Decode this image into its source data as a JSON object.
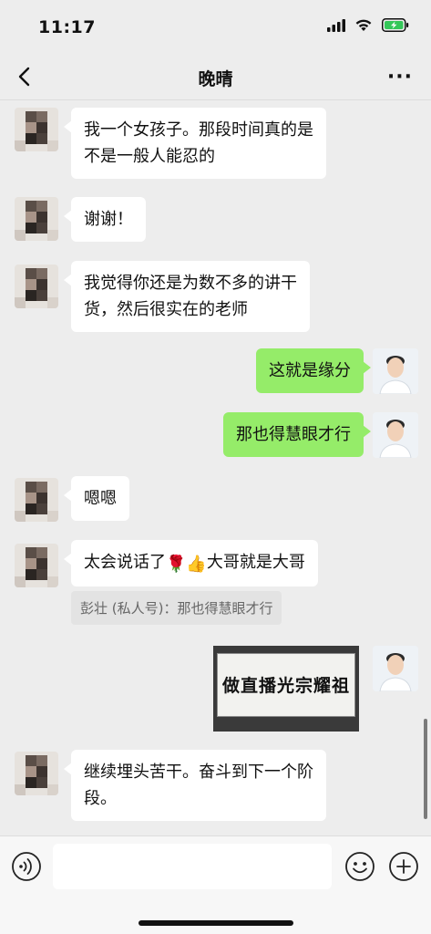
{
  "status": {
    "time": "11:17",
    "icons": [
      "signal-icon",
      "wifi-icon",
      "battery-charging-icon"
    ],
    "battery_color": "#34c759"
  },
  "nav": {
    "back_icon": "chevron-left-icon",
    "title": "晚晴",
    "more_label": "···"
  },
  "messages": [
    {
      "side": "left",
      "lines": [
        "我一个女孩子。那段时间真的是",
        "不是一般人能忍的"
      ]
    },
    {
      "side": "left",
      "text": "谢谢！"
    },
    {
      "side": "left",
      "lines": [
        "我觉得你还是为数不多的讲干",
        "货，然后很实在的老师"
      ]
    },
    {
      "side": "right",
      "text": "这就是缘分"
    },
    {
      "side": "right",
      "text": "那也得慧眼才行"
    },
    {
      "side": "left",
      "text": "嗯嗯"
    },
    {
      "side": "left",
      "text_before": "太会说话了",
      "emojis": [
        "🌹",
        "👍"
      ],
      "text_after": "大哥就是大哥"
    },
    {
      "side": "right",
      "image_text": "做直播光宗耀祖"
    },
    {
      "side": "left",
      "lines": [
        "继续埋头苦干。奋斗到下一个阶",
        "段。"
      ]
    }
  ],
  "quote": {
    "text": "彭壮 (私人号)：那也得慧眼才行"
  },
  "input_bar": {
    "voice_icon": "voice-icon",
    "emoji_icon": "emoji-icon",
    "plus_icon": "plus-icon",
    "input_value": ""
  },
  "colors": {
    "sent_bubble": "#95ec69",
    "received_bubble": "#ffffff",
    "background": "#ededed"
  }
}
